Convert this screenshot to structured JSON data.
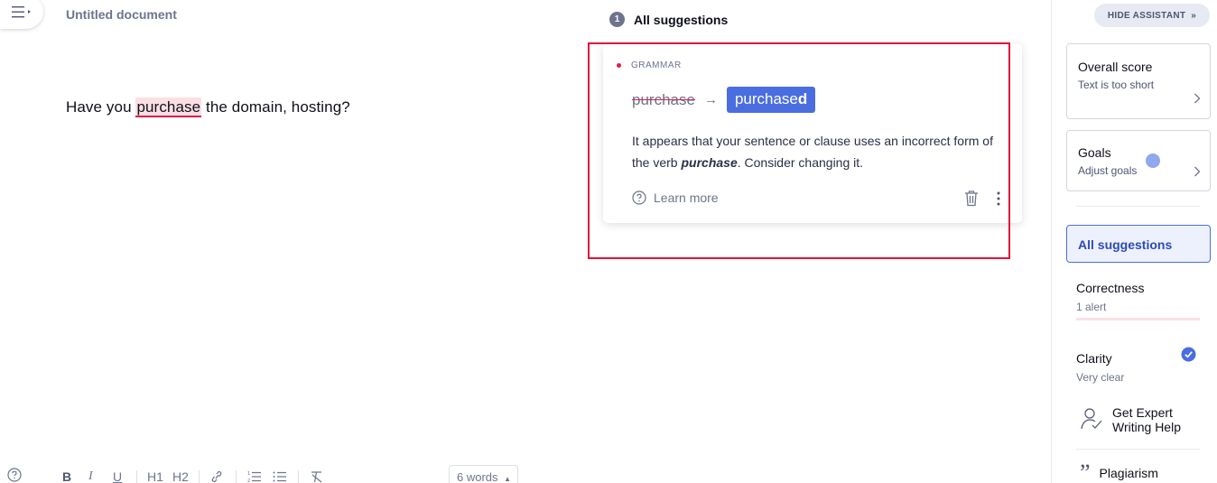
{
  "document": {
    "title": "Untitled document",
    "text_before": "Have you ",
    "flagged_word": "purchase",
    "text_after": " the domain, hosting?",
    "word_count": "6 words"
  },
  "suggestions_panel": {
    "count": "1",
    "title": "All suggestions",
    "card": {
      "category": "GRAMMAR",
      "original": "purchase",
      "replacement_base": "purchase",
      "replacement_suffix": "d",
      "explanation_before": "It appears that your sentence or clause uses an incorrect form of the verb ",
      "explanation_emphasis": "purchase",
      "explanation_after": ". Consider changing it.",
      "learn_more": "Learn more"
    }
  },
  "toolbar": {
    "help": "?",
    "bold": "B",
    "italic": "I",
    "underline": "U",
    "h1": "H1",
    "h2": "H2"
  },
  "assistant": {
    "hide_label": "HIDE ASSISTANT",
    "overall": {
      "title": "Overall score",
      "subtitle": "Text is too short"
    },
    "goals": {
      "title": "Goals",
      "subtitle": "Adjust goals"
    },
    "all_suggestions": "All suggestions",
    "correctness": {
      "title": "Correctness",
      "subtitle": "1 alert"
    },
    "clarity": {
      "title": "Clarity",
      "subtitle": "Very clear"
    },
    "expert": {
      "line1": "Get Expert",
      "line2": "Writing Help"
    },
    "plagiarism": "Plagiarism"
  },
  "colors": {
    "accent": "#4a6ee0",
    "alert": "#e01d46",
    "highlight_box": "#e0133a"
  }
}
